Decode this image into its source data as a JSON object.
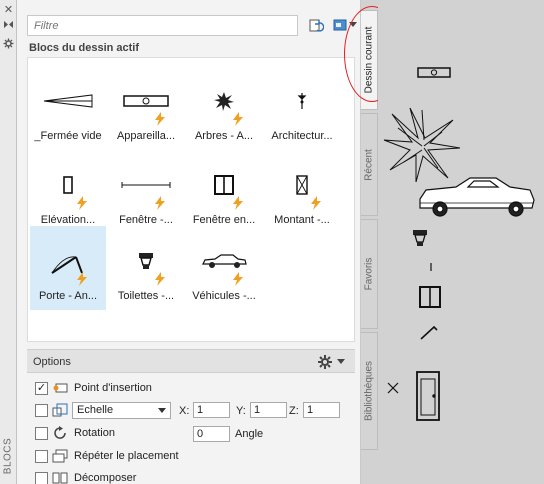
{
  "strip": {
    "label": "BLOCS",
    "icons": [
      "close-icon",
      "pin-icon",
      "settings-icon"
    ]
  },
  "toolbar": {
    "filter_placeholder": "Filtre",
    "buttons": [
      "sync-icon",
      "view-icon",
      "menu-arrow-icon"
    ]
  },
  "section": {
    "title": "Blocs du dessin actif"
  },
  "tiles": [
    {
      "label": "_Fermée vide",
      "icon": "closed-arrow-icon",
      "selected": false,
      "dynamic": false
    },
    {
      "label": "Appareilla...",
      "icon": "appliance-icon",
      "selected": false,
      "dynamic": true
    },
    {
      "label": "Arbres - A...",
      "icon": "tree-icon",
      "selected": false,
      "dynamic": true
    },
    {
      "label": "Architectur...",
      "icon": "architecture-icon",
      "selected": false,
      "dynamic": true
    },
    {
      "label": "Elévation...",
      "icon": "elevation-icon",
      "selected": false,
      "dynamic": true
    },
    {
      "label": "Fenêtre -...",
      "icon": "window-line-icon",
      "selected": false,
      "dynamic": true
    },
    {
      "label": "Fenêtre en...",
      "icon": "window-icon",
      "selected": false,
      "dynamic": true
    },
    {
      "label": "Montant -...",
      "icon": "post-icon",
      "selected": false,
      "dynamic": true
    },
    {
      "label": "Porte - An...",
      "icon": "door-icon",
      "selected": true,
      "dynamic": true
    },
    {
      "label": "Toilettes -...",
      "icon": "toilet-icon",
      "selected": false,
      "dynamic": true
    },
    {
      "label": "Véhicules -...",
      "icon": "car-icon",
      "selected": false,
      "dynamic": true
    }
  ],
  "options": {
    "title": "Options",
    "insertion_point": {
      "label": "Point d'insertion",
      "checked": true
    },
    "scale": {
      "checked": false,
      "select": "Echelle",
      "x_label": "X:",
      "x": "1",
      "y_label": "Y:",
      "y": "1",
      "z_label": "Z:",
      "z": "1"
    },
    "rotation": {
      "label": "Rotation",
      "checked": false,
      "value": "0",
      "angle_label": "Angle"
    },
    "repeat": {
      "label": "Répéter le placement",
      "checked": false
    },
    "explode": {
      "label": "Décomposer",
      "checked": false
    }
  },
  "tabs": [
    {
      "label": "Dessin courant",
      "active": true
    },
    {
      "label": "Récent",
      "active": false
    },
    {
      "label": "Favoris",
      "active": false
    },
    {
      "label": "Bibliothèques",
      "active": false
    }
  ],
  "colors": {
    "accent_bolt": "#f0a020",
    "selection": "#d7ebf8",
    "highlight_circle": "#e32020"
  }
}
